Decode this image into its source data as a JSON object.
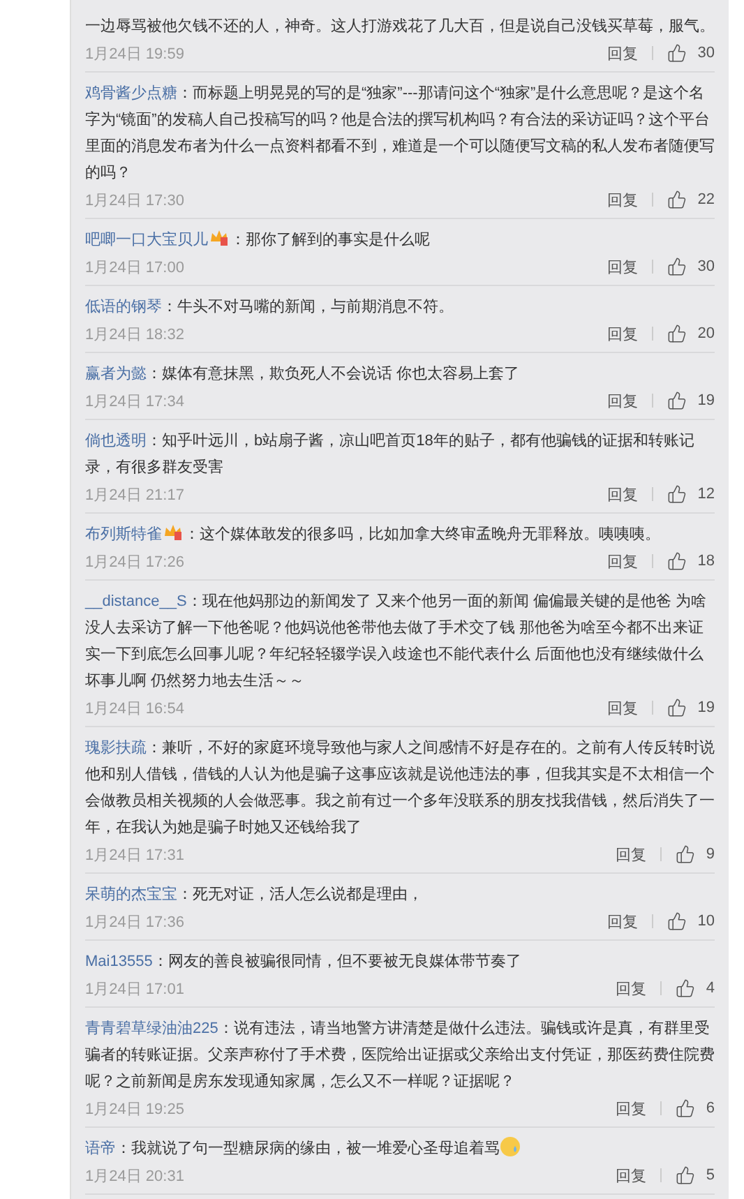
{
  "comments": [
    {
      "text": "一边辱骂被他欠钱不还的人，神奇。这人打游戏花了几大百，但是说自己没钱买草莓，服气。",
      "time": "1月24日 19:59",
      "reply": "回复",
      "likes": "30"
    },
    {
      "user": "鸡骨酱少点糖",
      "badge": false,
      "text": "：而标题上明晃晃的写的是“独家”---那请问这个“独家”是什么意思呢？是这个名字为“镜面”的发稿人自己投稿写的吗？他是合法的撰写机构吗？有合法的采访证吗？这个平台里面的消息发布者为什么一点资料都看不到，难道是一个可以随便写文稿的私人发布者随便写的吗？",
      "time": "1月24日 17:30",
      "reply": "回复",
      "likes": "22"
    },
    {
      "user": "吧唧一口大宝贝儿",
      "badge": true,
      "text": "：那你了解到的事实是什么呢",
      "time": "1月24日 17:00",
      "reply": "回复",
      "likes": "30"
    },
    {
      "user": "低语的钢琴",
      "badge": false,
      "text": "：牛头不对马嘴的新闻，与前期消息不符。",
      "time": "1月24日 18:32",
      "reply": "回复",
      "likes": "20"
    },
    {
      "user": "赢者为懿",
      "badge": false,
      "text": "：媒体有意抹黑，欺负死人不会说话 你也太容易上套了",
      "time": "1月24日 17:34",
      "reply": "回复",
      "likes": "19"
    },
    {
      "user": "倘也透明",
      "badge": false,
      "text": "：知乎叶远川，b站扇子酱，凉山吧首页18年的贴子，都有他骗钱的证据和转账记录，有很多群友受害",
      "time": "1月24日 21:17",
      "reply": "回复",
      "likes": "12"
    },
    {
      "user": "布列斯特雀",
      "badge": true,
      "text": "：这个媒体敢发的很多吗，比如加拿大终审孟晚舟无罪释放。咦咦咦。",
      "time": "1月24日 17:26",
      "reply": "回复",
      "likes": "18"
    },
    {
      "user": "__distance__S",
      "badge": false,
      "text": "：现在他妈那边的新闻发了 又来个他另一面的新闻 偏偏最关键的是他爸 为啥没人去采访了解一下他爸呢？他妈说他爸带他去做了手术交了钱 那他爸为啥至今都不出来证实一下到底怎么回事儿呢？年纪轻轻辍学误入歧途也不能代表什么 后面他也没有继续做什么坏事儿啊 仍然努力地去生活～～",
      "time": "1月24日 16:54",
      "reply": "回复",
      "likes": "19"
    },
    {
      "user": "瑰影扶疏",
      "badge": false,
      "text": "：兼听，不好的家庭环境导致他与家人之间感情不好是存在的。之前有人传反转时说他和别人借钱，借钱的人认为他是骗子这事应该就是说他违法的事，但我其实是不太相信一个会做教员相关视频的人会做恶事。我之前有过一个多年没联系的朋友找我借钱，然后消失了一年，在我认为她是骗子时她又还钱给我了",
      "time": "1月24日 17:31",
      "reply": "回复",
      "likes": "9"
    },
    {
      "user": "呆萌的杰宝宝",
      "badge": false,
      "text": "：死无对证，活人怎么说都是理由，",
      "time": "1月24日 17:36",
      "reply": "回复",
      "likes": "10"
    },
    {
      "user": "Mai13555",
      "badge": false,
      "text": "：网友的善良被骗很同情，但不要被无良媒体带节奏了",
      "time": "1月24日 17:01",
      "reply": "回复",
      "likes": "4"
    },
    {
      "user": "青青碧草绿油油225",
      "badge": false,
      "text": "：说有违法，请当地警方讲清楚是做什么违法。骗钱或许是真，有群里受骗者的转账证据。父亲声称付了手术费，医院给出证据或父亲给出支付凭证，那医药费住院费呢？之前新闻是房东发现通知家属，怎么又不一样呢？证据呢？",
      "time": "1月24日 19:25",
      "reply": "回复",
      "likes": "6"
    },
    {
      "user": "语帝",
      "badge": false,
      "text": "：我就说了句一型糖尿病的缘由，被一堆爱心圣母追着骂",
      "emoji": true,
      "time": "1月24日 20:31",
      "reply": "回复",
      "likes": "5"
    }
  ]
}
